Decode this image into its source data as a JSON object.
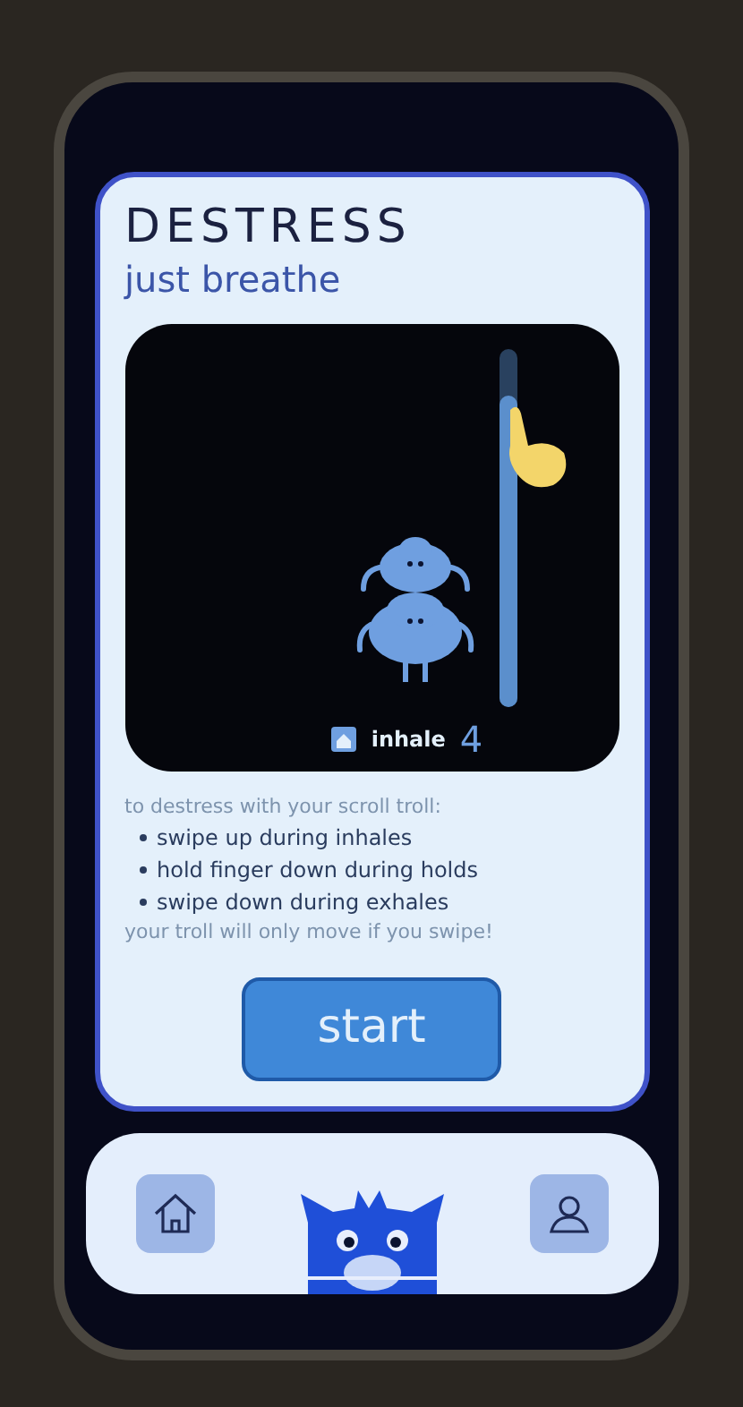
{
  "card": {
    "title": "DESTRESS",
    "subtitle": "just breathe",
    "demo": {
      "phase": "inhale",
      "count": "4"
    },
    "intro": "to destress with your scroll troll:",
    "steps": [
      "swipe up during inhales",
      "hold finger down during holds",
      "swipe down during exhales"
    ],
    "note": "your troll will only move if you swipe!",
    "start_button": "start"
  },
  "nav": {
    "items": [
      {
        "kind": "home"
      },
      {
        "kind": "troll"
      },
      {
        "kind": "profile"
      }
    ]
  }
}
